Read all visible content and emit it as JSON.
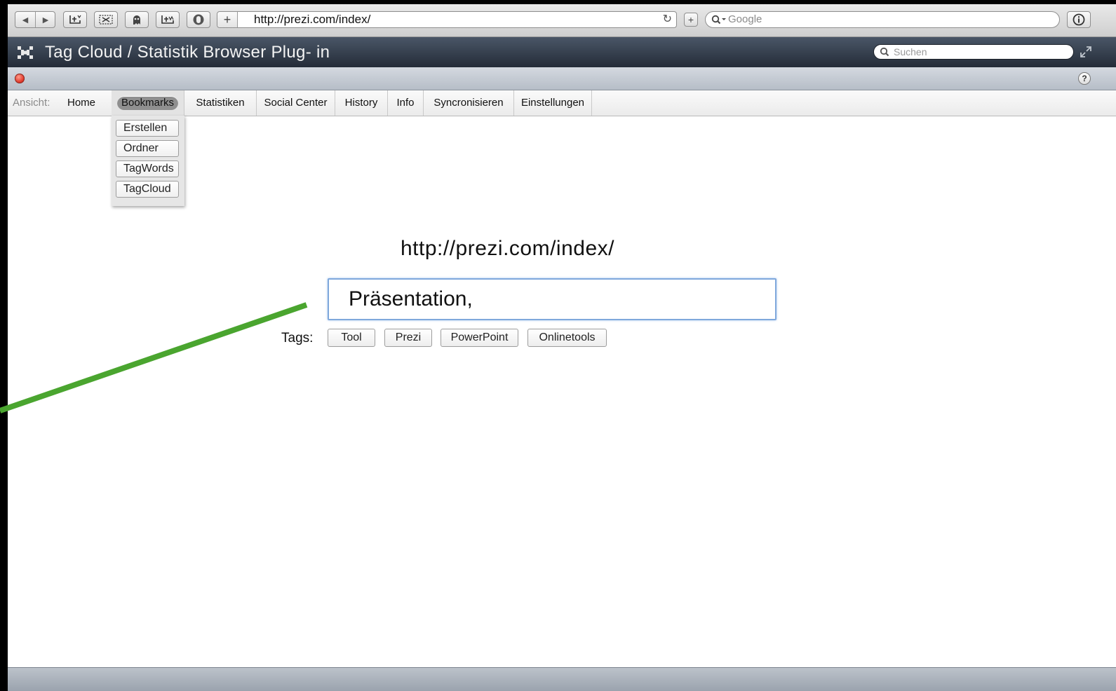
{
  "browser": {
    "url": "http://prezi.com/index/",
    "search_placeholder": "Google",
    "new_tab_symbol": "+",
    "reload_symbol": "↻",
    "add_symbol": "+",
    "icons": [
      "back-arrow-icon",
      "forward-arrow-icon",
      "bookmark-add-icon",
      "cut-icon",
      "ghost-icon",
      "bookmark-tag-icon",
      "hand-icon",
      "info-icon"
    ]
  },
  "plugin": {
    "title": "Tag Cloud / Statistik Browser Plug- in",
    "search_placeholder": "Suchen",
    "help_symbol": "?"
  },
  "nav": {
    "label": "Ansicht:",
    "tabs": [
      {
        "label": "Home"
      },
      {
        "label": "Bookmarks",
        "active": true
      },
      {
        "label": "Statistiken"
      },
      {
        "label": "Social Center"
      },
      {
        "label": "History"
      },
      {
        "label": "Info"
      },
      {
        "label": "Syncronisieren"
      },
      {
        "label": "Einstellungen"
      }
    ]
  },
  "dropdown": {
    "items": [
      {
        "label": "Erstellen"
      },
      {
        "label": "Ordner"
      },
      {
        "label": "TagWords"
      },
      {
        "label": "TagCloud"
      }
    ]
  },
  "main": {
    "page_url": "http://prezi.com/index/",
    "tag_input_value": "Präsentation,",
    "tags_label": "Tags:",
    "tags": [
      "Tool",
      "Prezi",
      "PowerPoint",
      "Onlinetools"
    ]
  },
  "colors": {
    "annotation_line": "#4aa52f",
    "title_bar": "#2f3845",
    "input_focus": "#7fa8dc"
  }
}
